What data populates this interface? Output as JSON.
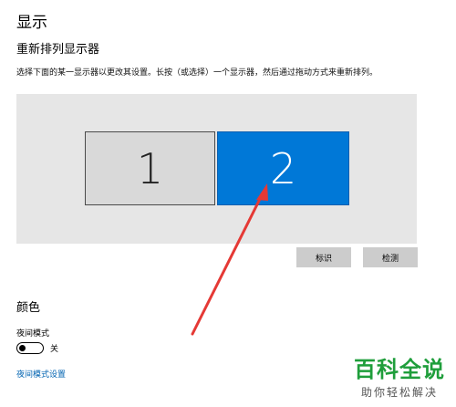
{
  "page": {
    "title": "显示",
    "rearrange_heading": "重新排列显示器",
    "instruction": "选择下面的某一显示器以更改其设置。长按（或选择）一个显示器，然后通过拖动方式来重新排列。"
  },
  "monitors": [
    {
      "label": "1"
    },
    {
      "label": "2"
    }
  ],
  "buttons": {
    "identify": "标识",
    "detect": "检测"
  },
  "color_section": {
    "heading": "颜色",
    "night_mode_label": "夜间模式",
    "night_mode_state": "关",
    "night_mode_link": "夜间模式设置"
  },
  "colors": {
    "accent": "#0078d7",
    "annotation_arrow": "#e53935",
    "watermark": "#1f9e3b"
  },
  "watermark": {
    "main": "百科全说",
    "sub": "助你轻松解决"
  }
}
